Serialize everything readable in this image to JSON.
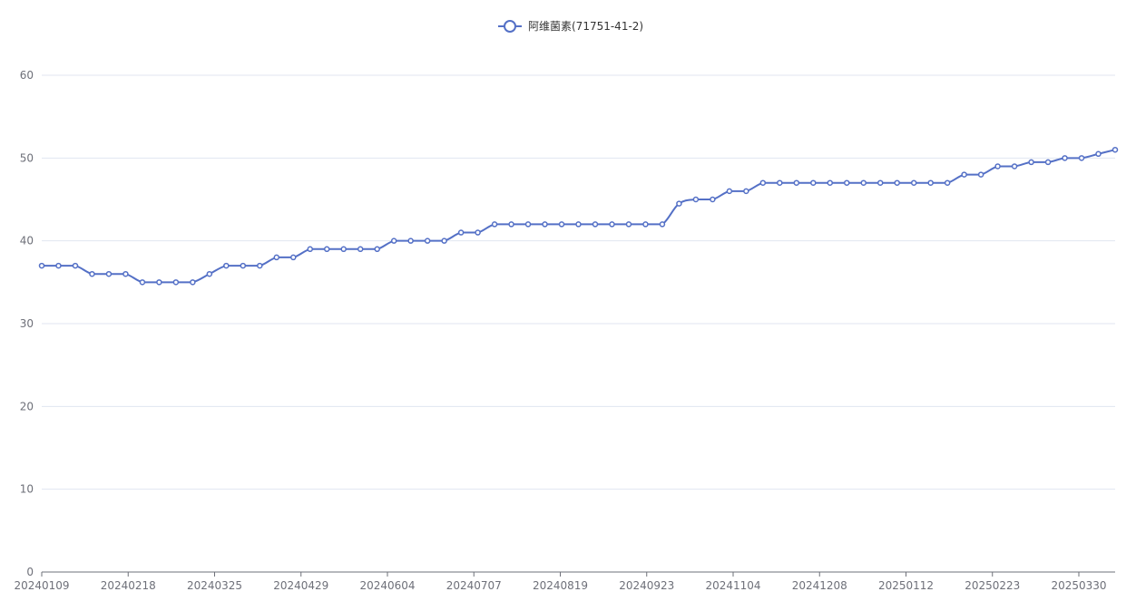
{
  "colors": {
    "series": "#5470c6"
  },
  "chart_data": {
    "type": "line",
    "legend": {
      "placement": "top-center",
      "marker_icon": "circle-line-icon"
    },
    "grid": true,
    "ylim": [
      0,
      60
    ],
    "yticks": [
      0,
      10,
      20,
      30,
      40,
      50,
      60
    ],
    "x_tick_labels": [
      "20240109",
      "20240218",
      "20240325",
      "20240429",
      "20240604",
      "20240707",
      "20240819",
      "20240923",
      "20241104",
      "20241208",
      "20250112",
      "20250223",
      "20250330"
    ],
    "series": [
      {
        "name": "阿维菌素(71751-41-2)",
        "values": [
          37,
          37,
          37,
          36,
          36,
          36,
          35,
          35,
          35,
          35,
          36,
          37,
          37,
          37,
          38,
          38,
          39,
          39,
          39,
          39,
          39,
          40,
          40,
          40,
          40,
          41,
          41,
          42,
          42,
          42,
          42,
          42,
          42,
          42,
          42,
          42,
          42,
          42,
          44.5,
          45,
          45,
          46,
          46,
          47,
          47,
          47,
          47,
          47,
          47,
          47,
          47,
          47,
          47,
          47,
          47,
          48,
          48,
          49,
          49,
          49.5,
          49.5,
          50,
          50,
          50.5,
          51
        ]
      }
    ]
  }
}
